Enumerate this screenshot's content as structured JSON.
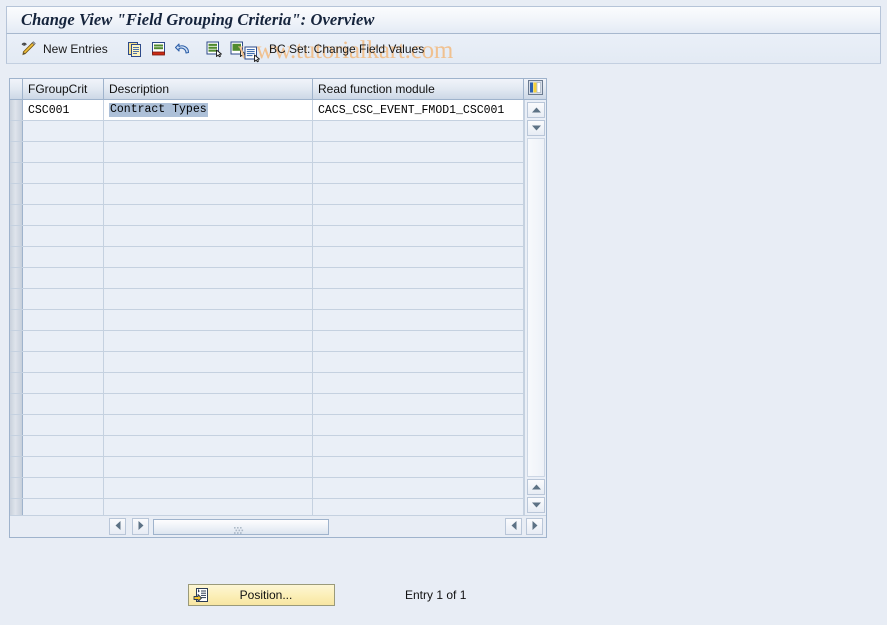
{
  "window": {
    "title": "Change View \"Field Grouping Criteria\": Overview"
  },
  "watermark": {
    "text": "www.tutorialkart.com",
    "color": "#f0c190"
  },
  "toolbar": {
    "new_entries_label": "New Entries",
    "bc_set_label": "BC Set: Change Field Values",
    "icons": [
      {
        "name": "pencil-icon",
        "title": "New Entries"
      },
      {
        "name": "copy-icon",
        "title": "Copy As..."
      },
      {
        "name": "delete-icon",
        "title": "Delete"
      },
      {
        "name": "undo-icon",
        "title": "Undo Change"
      },
      {
        "name": "select-all-icon",
        "title": "Select All"
      },
      {
        "name": "select-block-icon",
        "title": "Select Block"
      },
      {
        "name": "bc-set-icon",
        "title": "BC Set: Change Field Values"
      }
    ]
  },
  "table": {
    "columns": [
      {
        "key": "fgroupcrit",
        "label": "FGroupCrit"
      },
      {
        "key": "description",
        "label": "Description"
      },
      {
        "key": "readfm",
        "label": "Read function module"
      }
    ],
    "config_icon": "column-settings-icon",
    "rows": [
      {
        "fgroupcrit": "CSC001",
        "description": "Contract Types",
        "readfm": "CACS_CSC_EVENT_FMOD1_CSC001",
        "description_selected": true
      }
    ],
    "empty_row_count": 19,
    "scroll": {
      "up_icon": "scroll-up-icon",
      "down_icon": "scroll-down-icon",
      "left_icon": "scroll-left-icon",
      "right_icon": "scroll-right-icon",
      "grip_icon": "scroll-grip-icon"
    }
  },
  "footer": {
    "position_button_label": "Position...",
    "position_button_icon": "position-icon",
    "entry_status": "Entry 1 of 1"
  }
}
